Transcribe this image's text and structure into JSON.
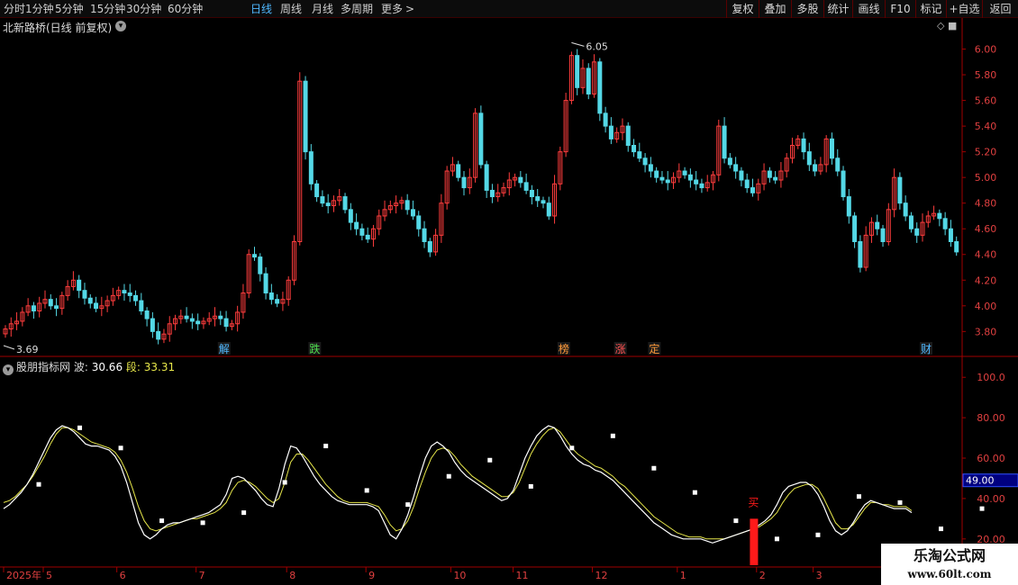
{
  "toolbar": {
    "timeframes": [
      "分时",
      "1分钟",
      "5分钟",
      "15分钟",
      "30分钟",
      "60分钟",
      "日线",
      "周线",
      "月线",
      "多周期",
      "更多"
    ],
    "active": "日线",
    "more_arrow": ">",
    "right_buttons": [
      "复权",
      "叠加",
      "多股",
      "统计",
      "画线",
      "F10",
      "标记",
      "+自选",
      "返回"
    ]
  },
  "main_chart": {
    "title": "北新路桥(日线 前复权)",
    "dropdown_icon": "chevron-down-icon",
    "corner_icons": "◇ ■",
    "high_label": "6.05",
    "low_label": "3.69",
    "y_axis": [
      "6.00",
      "5.80",
      "5.60",
      "5.40",
      "5.20",
      "5.00",
      "4.80",
      "4.60",
      "4.40",
      "4.20",
      "4.00",
      "3.80"
    ],
    "ylim": [
      3.62,
      6.13
    ],
    "events": [
      {
        "label": "解",
        "color": "#4fb8ff"
      },
      {
        "label": "跌",
        "color": "#4fdc4f"
      },
      {
        "label": "榜",
        "color": "#ff9a3a"
      },
      {
        "label": "涨",
        "color": "#ff5050"
      },
      {
        "label": "定",
        "color": "#ff9a3a"
      },
      {
        "label": "财",
        "color": "#4fb8ff"
      }
    ]
  },
  "indicator": {
    "name": "股朋指标网",
    "wave_label": "波:",
    "wave_value": "30.66",
    "seg_label": "段:",
    "seg_value": "33.31",
    "y_axis": [
      "100.0",
      "80.00",
      "60.00",
      "40.00",
      "20.00"
    ],
    "ylim": [
      7,
      105
    ],
    "current_value": "49.00",
    "buy_label": "买",
    "wave_series": [
      35,
      37,
      40,
      43,
      47,
      52,
      58,
      64,
      70,
      74,
      76,
      75,
      73,
      70,
      67,
      66,
      66,
      65,
      64,
      61,
      56,
      48,
      38,
      28,
      22,
      20,
      22,
      25,
      27,
      28,
      28,
      29,
      30,
      31,
      32,
      33,
      35,
      37,
      42,
      50,
      51,
      50,
      47,
      44,
      40,
      37,
      36,
      45,
      57,
      66,
      65,
      61,
      56,
      51,
      47,
      44,
      41,
      39,
      38,
      37,
      37,
      37,
      37,
      36,
      34,
      28,
      22,
      20,
      25,
      32,
      41,
      51,
      60,
      66,
      68,
      66,
      63,
      58,
      54,
      51,
      49,
      47,
      45,
      43,
      41,
      39,
      40,
      44,
      52,
      60,
      66,
      71,
      74,
      76,
      75,
      71,
      66,
      62,
      59,
      57,
      56,
      54,
      53,
      51,
      49,
      46,
      43,
      40,
      37,
      34,
      31,
      28,
      26,
      24,
      22,
      21,
      20,
      20,
      20,
      20,
      19,
      18,
      19,
      20,
      21,
      22,
      23,
      24,
      25,
      27,
      29,
      32,
      37,
      43,
      46,
      47,
      48,
      48,
      46,
      42,
      36,
      29,
      24,
      22,
      24,
      28,
      33,
      37,
      39,
      38,
      37,
      36,
      35,
      35,
      35,
      33
    ],
    "seg_series": [
      38,
      39,
      41,
      44,
      47,
      51,
      56,
      61,
      67,
      72,
      75,
      75,
      74,
      72,
      70,
      68,
      67,
      66,
      65,
      63,
      59,
      53,
      45,
      36,
      29,
      25,
      24,
      25,
      26,
      27,
      28,
      29,
      30,
      30,
      31,
      32,
      33,
      35,
      38,
      44,
      48,
      49,
      48,
      46,
      43,
      40,
      38,
      40,
      48,
      58,
      62,
      62,
      59,
      55,
      51,
      47,
      44,
      41,
      39,
      38,
      38,
      38,
      38,
      37,
      36,
      32,
      27,
      24,
      25,
      29,
      36,
      45,
      53,
      60,
      64,
      65,
      64,
      61,
      57,
      54,
      51,
      49,
      47,
      45,
      43,
      41,
      41,
      43,
      48,
      55,
      62,
      67,
      71,
      74,
      75,
      73,
      69,
      65,
      62,
      60,
      58,
      56,
      55,
      53,
      51,
      48,
      46,
      43,
      40,
      37,
      34,
      31,
      29,
      27,
      25,
      23,
      22,
      21,
      21,
      21,
      20,
      20,
      20,
      20,
      21,
      22,
      23,
      24,
      25,
      26,
      28,
      30,
      33,
      38,
      42,
      45,
      46,
      47,
      47,
      45,
      40,
      34,
      28,
      25,
      25,
      27,
      31,
      35,
      38,
      38,
      37,
      37,
      36,
      36,
      36,
      34
    ],
    "markers": [
      {
        "i": 6,
        "v": 47
      },
      {
        "i": 13,
        "v": 75
      },
      {
        "i": 20,
        "v": 65
      },
      {
        "i": 27,
        "v": 29
      },
      {
        "i": 34,
        "v": 28
      },
      {
        "i": 41,
        "v": 33
      },
      {
        "i": 48,
        "v": 48
      },
      {
        "i": 55,
        "v": 66
      },
      {
        "i": 62,
        "v": 44
      },
      {
        "i": 69,
        "v": 37
      },
      {
        "i": 76,
        "v": 51
      },
      {
        "i": 83,
        "v": 59
      },
      {
        "i": 90,
        "v": 46
      },
      {
        "i": 97,
        "v": 65
      },
      {
        "i": 104,
        "v": 71
      },
      {
        "i": 111,
        "v": 55
      },
      {
        "i": 118,
        "v": 43
      },
      {
        "i": 125,
        "v": 29
      },
      {
        "i": 132,
        "v": 20
      },
      {
        "i": 139,
        "v": 22
      },
      {
        "i": 146,
        "v": 41
      },
      {
        "i": 153,
        "v": 38
      },
      {
        "i": 160,
        "v": 25
      },
      {
        "i": 167,
        "v": 35
      }
    ],
    "buy_bar": {
      "i": 128,
      "from": 7,
      "to": 30
    }
  },
  "x_axis": {
    "labels": [
      {
        "text": "2025年",
        "i": 0
      },
      {
        "text": "5",
        "i": 7
      },
      {
        "text": "6",
        "i": 20
      },
      {
        "text": "7",
        "i": 34
      },
      {
        "text": "8",
        "i": 50
      },
      {
        "text": "9",
        "i": 64
      },
      {
        "text": "10",
        "i": 79
      },
      {
        "text": "11",
        "i": 90
      },
      {
        "text": "12",
        "i": 104
      },
      {
        "text": "1",
        "i": 119
      },
      {
        "text": "2",
        "i": 133
      },
      {
        "text": "3",
        "i": 143
      }
    ]
  },
  "watermark": {
    "line1": "乐淘公式网",
    "line2": "www.60lt.com"
  },
  "colors": {
    "up": "#ff3d3d",
    "down": "#54d8e6",
    "wave": "#ffffff",
    "seg": "#e6e64a",
    "grid": "#2a0a0a",
    "axis": "#a00000",
    "buy": "#ff1a1a"
  },
  "chart_data": {
    "type": "candlestick",
    "title": "北新路桥(日线 前复权)",
    "ylim": [
      3.62,
      6.13
    ],
    "high_label": 6.05,
    "low_label": 3.69,
    "close_series": [
      3.82,
      3.86,
      3.88,
      3.95,
      4.0,
      3.96,
      4.02,
      4.05,
      4.0,
      3.98,
      4.08,
      4.15,
      4.2,
      4.12,
      4.06,
      4.02,
      3.98,
      4.0,
      4.04,
      4.08,
      4.12,
      4.1,
      4.08,
      4.04,
      3.96,
      3.9,
      3.8,
      3.74,
      3.78,
      3.86,
      3.9,
      3.92,
      3.9,
      3.88,
      3.86,
      3.88,
      3.9,
      3.92,
      3.9,
      3.84,
      3.86,
      3.95,
      4.1,
      4.4,
      4.38,
      4.25,
      4.1,
      4.05,
      4.02,
      4.05,
      4.2,
      4.5,
      5.75,
      5.2,
      4.95,
      4.85,
      4.8,
      4.78,
      4.82,
      4.85,
      4.75,
      4.65,
      4.6,
      4.55,
      4.52,
      4.6,
      4.7,
      4.75,
      4.78,
      4.8,
      4.82,
      4.75,
      4.7,
      4.6,
      4.5,
      4.42,
      4.55,
      4.8,
      5.05,
      5.1,
      5.0,
      4.92,
      5.0,
      5.5,
      5.1,
      4.9,
      4.85,
      4.88,
      4.92,
      4.98,
      5.0,
      4.96,
      4.9,
      4.85,
      4.82,
      4.8,
      4.7,
      4.95,
      5.2,
      5.6,
      5.95,
      5.7,
      5.85,
      5.65,
      5.9,
      5.5,
      5.4,
      5.3,
      5.35,
      5.4,
      5.25,
      5.2,
      5.15,
      5.1,
      5.05,
      5.0,
      4.98,
      4.96,
      5.0,
      5.05,
      5.02,
      4.98,
      4.95,
      4.92,
      4.96,
      5.02,
      5.4,
      5.15,
      5.1,
      5.05,
      4.98,
      4.92,
      4.88,
      4.95,
      5.05,
      5.0,
      4.98,
      5.05,
      5.15,
      5.25,
      5.3,
      5.2,
      5.1,
      5.05,
      5.1,
      5.3,
      5.15,
      5.05,
      4.85,
      4.7,
      4.5,
      4.3,
      4.55,
      4.65,
      4.6,
      4.5,
      4.75,
      5.0,
      4.8,
      4.7,
      4.6,
      4.55,
      4.65,
      4.7,
      4.72,
      4.68,
      4.6,
      4.5,
      4.42
    ]
  }
}
